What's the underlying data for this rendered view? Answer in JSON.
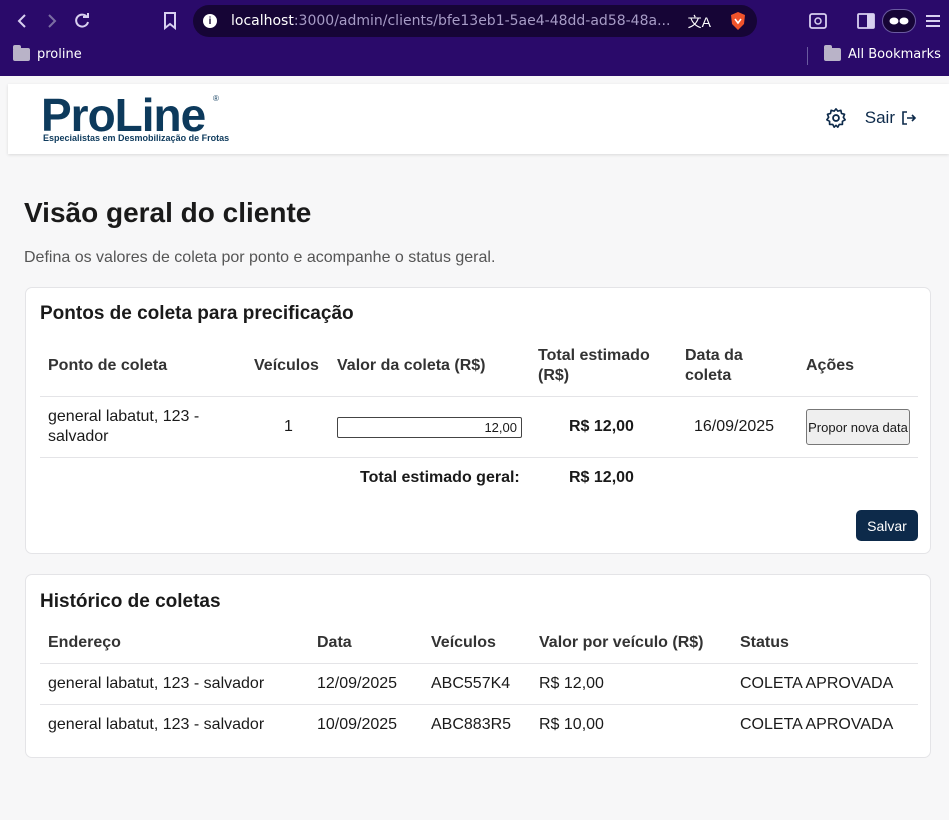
{
  "browser": {
    "url_host": "localhost",
    "url_rest": ":3000/admin/clients/bfe13eb1-5ae4-48dd-ad58-48a...",
    "bookmarks": {
      "folder": "proline",
      "all": "All Bookmarks"
    }
  },
  "header": {
    "logo_text": "ProLine",
    "logo_reg": "®",
    "logo_tagline": "Especialistas em Desmobilização de Frotas",
    "sair_label": "Sair"
  },
  "page": {
    "title": "Visão geral do cliente",
    "subtitle": "Defina os valores de coleta por ponto e acompanhe o status geral."
  },
  "pricing": {
    "title": "Pontos de coleta para precificação",
    "columns": [
      "Ponto de coleta",
      "Veículos",
      "Valor da coleta (R$)",
      "Total estimado (R$)",
      "Data da coleta",
      "Ações"
    ],
    "rows": [
      {
        "ponto": "general labatut, 123 - salvador",
        "veiculos": "1",
        "valor": "12,00",
        "total": "R$ 12,00",
        "data": "16/09/2025",
        "acao": "Propor nova data"
      }
    ],
    "total_label": "Total estimado geral:",
    "total_value": "R$ 12,00",
    "save_label": "Salvar"
  },
  "history": {
    "title": "Histórico de coletas",
    "columns": [
      "Endereço",
      "Data",
      "Veículos",
      "Valor por veículo (R$)",
      "Status"
    ],
    "rows": [
      {
        "endereco": "general labatut, 123 - salvador",
        "data": "12/09/2025",
        "veiculos": "ABC557K4",
        "valor": "R$ 12,00",
        "status": "COLETA APROVADA"
      },
      {
        "endereco": "general labatut, 123 - salvador",
        "data": "10/09/2025",
        "veiculos": "ABC883R5",
        "valor": "R$ 10,00",
        "status": "COLETA APROVADA"
      }
    ]
  }
}
